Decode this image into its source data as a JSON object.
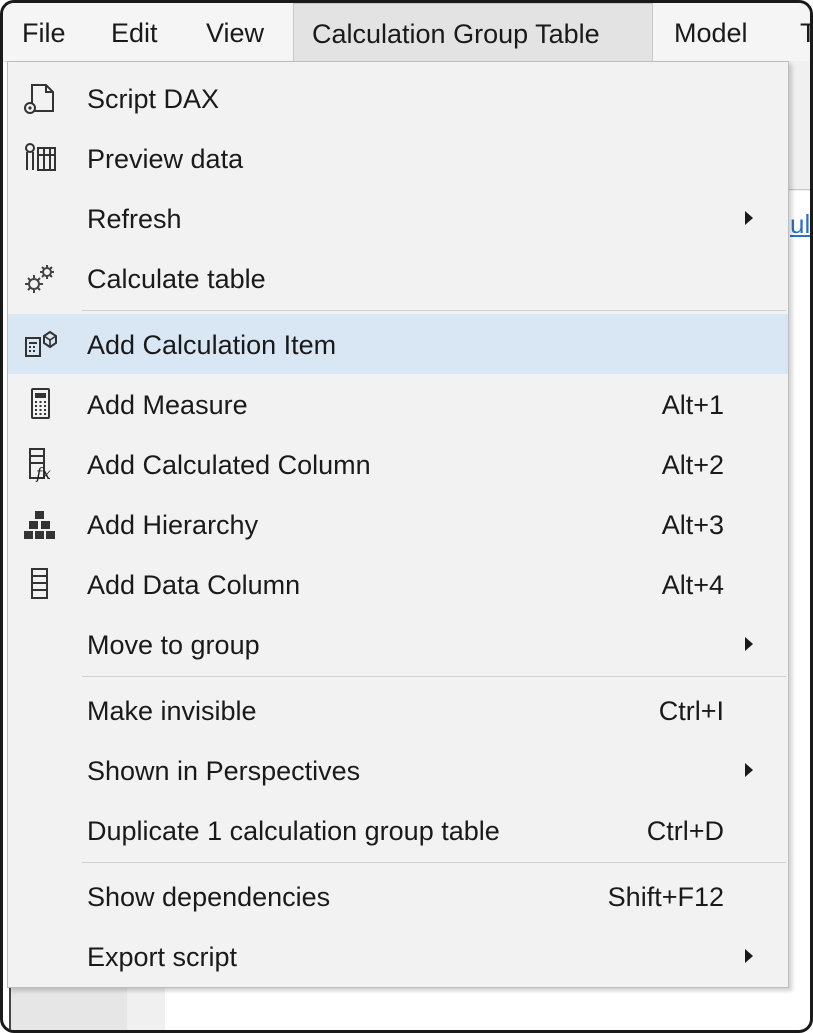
{
  "menubar": {
    "items": [
      {
        "label": "File"
      },
      {
        "label": "Edit"
      },
      {
        "label": "View"
      },
      {
        "label": "Calculation Group Table"
      },
      {
        "label": "Model"
      },
      {
        "label": "T"
      }
    ]
  },
  "background": {
    "link_text": "ula"
  },
  "menu": {
    "items": [
      {
        "label": "Script DAX",
        "shortcut": "",
        "icon": "script-dax-icon"
      },
      {
        "label": "Preview data",
        "shortcut": "",
        "icon": "preview-data-icon"
      },
      {
        "label": "Refresh",
        "shortcut": "",
        "submenu": true
      },
      {
        "label": "Calculate table",
        "shortcut": "",
        "icon": "gears-icon"
      },
      {
        "label": "Add Calculation Item",
        "shortcut": "",
        "icon": "calculation-item-icon",
        "highlighted": true
      },
      {
        "label": "Add Measure",
        "shortcut": "Alt+1",
        "icon": "calculator-icon"
      },
      {
        "label": "Add Calculated Column",
        "shortcut": "Alt+2",
        "icon": "calculated-column-icon"
      },
      {
        "label": "Add Hierarchy",
        "shortcut": "Alt+3",
        "icon": "hierarchy-icon"
      },
      {
        "label": "Add Data Column",
        "shortcut": "Alt+4",
        "icon": "data-column-icon"
      },
      {
        "label": "Move to group",
        "shortcut": "",
        "submenu": true
      },
      {
        "label": "Make invisible",
        "shortcut": "Ctrl+I"
      },
      {
        "label": "Shown in Perspectives",
        "shortcut": "",
        "submenu": true
      },
      {
        "label": "Duplicate 1 calculation group table",
        "shortcut": "Ctrl+D"
      },
      {
        "label": "Show dependencies",
        "shortcut": "Shift+F12"
      },
      {
        "label": "Export script",
        "shortcut": "",
        "submenu": true
      }
    ]
  },
  "colors": {
    "highlight": "#d9e6f4",
    "menu_background": "#f2f2f2",
    "link": "#2a6fc9"
  }
}
